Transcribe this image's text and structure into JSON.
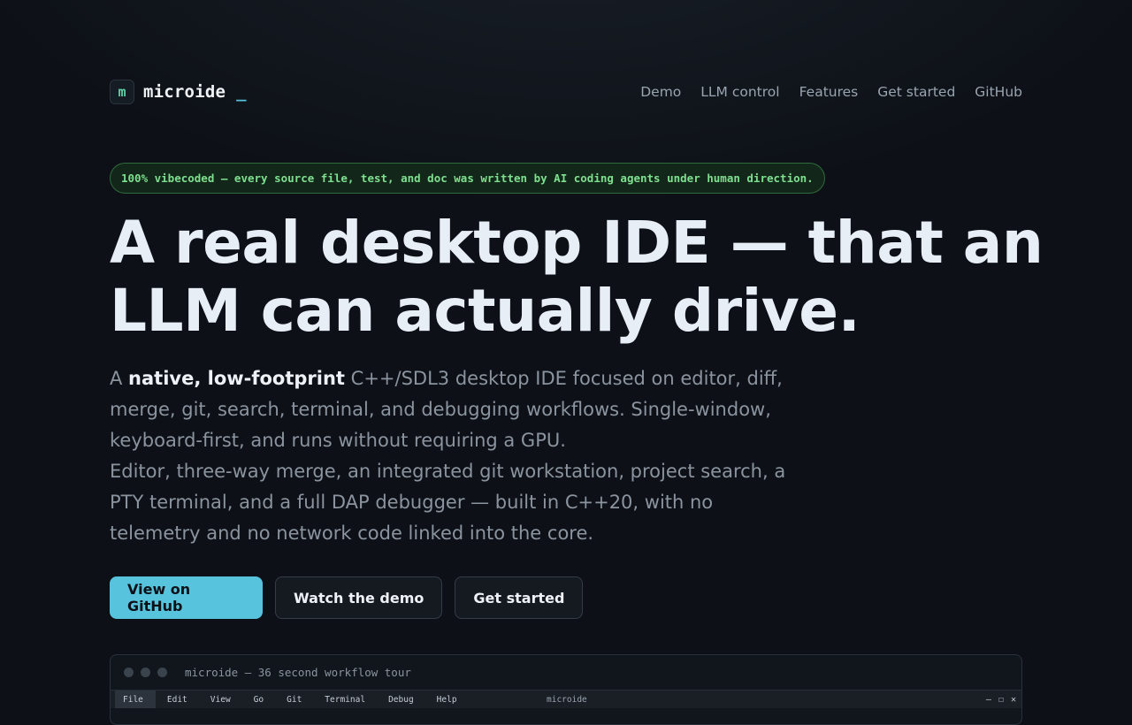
{
  "brand": {
    "logo_glyph": "m",
    "name": "microide",
    "cursor": "_"
  },
  "nav": {
    "links": [
      {
        "label": "Demo"
      },
      {
        "label": "LLM control"
      },
      {
        "label": "Features"
      },
      {
        "label": "Get started"
      },
      {
        "label": "GitHub"
      }
    ]
  },
  "badge": {
    "text": "100% vibecoded — every source file, test, and doc was written by AI coding agents under human direction."
  },
  "hero": {
    "headline": "A real desktop IDE — that an LLM can actually drive.",
    "lede_prefix": "A ",
    "lede_bold": "native, low-footprint",
    "lede_rest": " C++/SDL3 desktop IDE focused on editor, diff, merge, git, search, terminal, and debugging workflows. Single-window, keyboard-first, and runs without requiring a GPU.",
    "lede_second": "Editor, three-way merge, an integrated git workstation, project search, a PTY terminal, and a full DAP debugger — built in C++20, with no telemetry and no network code linked into the core."
  },
  "buttons": {
    "primary": "View on GitHub",
    "demo": "Watch the demo",
    "get_started": "Get started"
  },
  "demo_window": {
    "title": "microide — 36 second workflow tour",
    "menus": [
      {
        "label": "File"
      },
      {
        "label": "Edit"
      },
      {
        "label": "View"
      },
      {
        "label": "Go"
      },
      {
        "label": "Git"
      },
      {
        "label": "Terminal"
      },
      {
        "label": "Debug"
      },
      {
        "label": "Help"
      }
    ],
    "app_name": "microide",
    "window_controls": {
      "minimize": "—",
      "maximize": "☐",
      "close": "✕"
    }
  },
  "colors": {
    "background": "#0d1117",
    "accent": "#57c3dd",
    "badge_green": "#7ee08f",
    "logo_green": "#5fd3a8"
  }
}
